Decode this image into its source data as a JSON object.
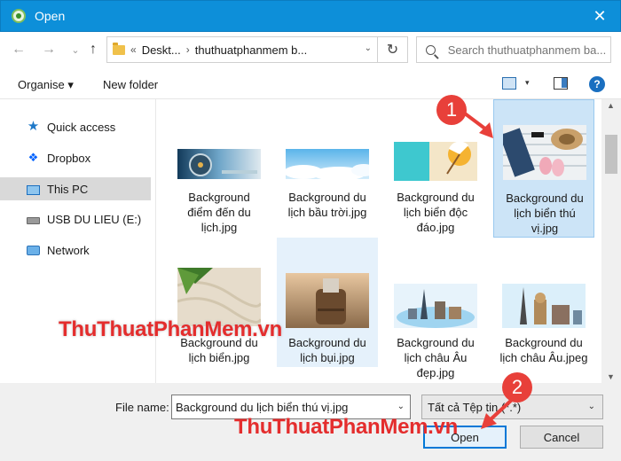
{
  "window": {
    "title": "Open",
    "close_glyph": "✕"
  },
  "nav_buttons": {
    "back": "←",
    "forward": "→",
    "dropdown": "⌄",
    "up": "↑"
  },
  "address": {
    "overflow": "«",
    "segments": [
      "Deskt...",
      "thuthuatphanmem b..."
    ],
    "separator": "›",
    "dropdown_glyph": "⌄",
    "refresh_glyph": "↻"
  },
  "search": {
    "placeholder": "Search thuthuatphanmem ba..."
  },
  "toolbar": {
    "organise": "Organise ▾",
    "new_folder": "New folder",
    "view_menu_glyph": "▾",
    "help_glyph": "?"
  },
  "navigation": [
    {
      "label": "Quick access",
      "icon": "star-icon"
    },
    {
      "label": "Dropbox",
      "icon": "dropbox-icon"
    },
    {
      "label": "This PC",
      "icon": "pc-icon",
      "selected": true
    },
    {
      "label": "USB DU LIEU (E:)",
      "icon": "usb-icon"
    },
    {
      "label": "Network",
      "icon": "network-icon"
    }
  ],
  "files": [
    {
      "name_lines": [
        "Background",
        "điểm đến du",
        "lịch.jpg"
      ],
      "thumb": "compass-travel"
    },
    {
      "name_lines": [
        "Background du",
        "lịch bầu trời.jpg"
      ],
      "thumb": "sky-clouds"
    },
    {
      "name_lines": [
        "Background du",
        "lịch biển độc",
        "đáo.jpg"
      ],
      "thumb": "beach-umbrella"
    },
    {
      "name_lines": [
        "Background du",
        "lịch biển thú",
        "vị.jpg"
      ],
      "thumb": "beach-accessories",
      "selected": true
    },
    {
      "name_lines": [
        "Background du",
        "lịch biển.jpg"
      ],
      "thumb": "palm-sand"
    },
    {
      "name_lines": [
        "Background du",
        "lịch bụi.jpg"
      ],
      "thumb": "backpack",
      "hover": true
    },
    {
      "name_lines": [
        "Background du",
        "lịch châu Âu",
        "đẹp.jpg"
      ],
      "thumb": "europe-landmarks"
    },
    {
      "name_lines": [
        "Background du",
        "lịch châu Âu.jpeg"
      ],
      "thumb": "europe-monuments"
    }
  ],
  "scrollbar": {
    "up_glyph": "▲",
    "down_glyph": "▼"
  },
  "bottom": {
    "filename_label": "File name:",
    "filename_value": "Background du lịch biển thú vị.jpg",
    "filetype": "Tất cả Tệp tin (*.*)",
    "dropdown_glyph": "⌄",
    "open": "Open",
    "cancel": "Cancel"
  },
  "annotations": {
    "step1": "1",
    "step2": "2"
  },
  "watermark": {
    "part1": "ThuThuat",
    "part2": "PhanMem",
    "part3": ".vn"
  },
  "colors": {
    "titlebar": "#0d8fd9",
    "selection": "#cce4f7",
    "accent": "#0078d7",
    "badge": "#e8403a",
    "watermark_red": "#e42d2d"
  }
}
